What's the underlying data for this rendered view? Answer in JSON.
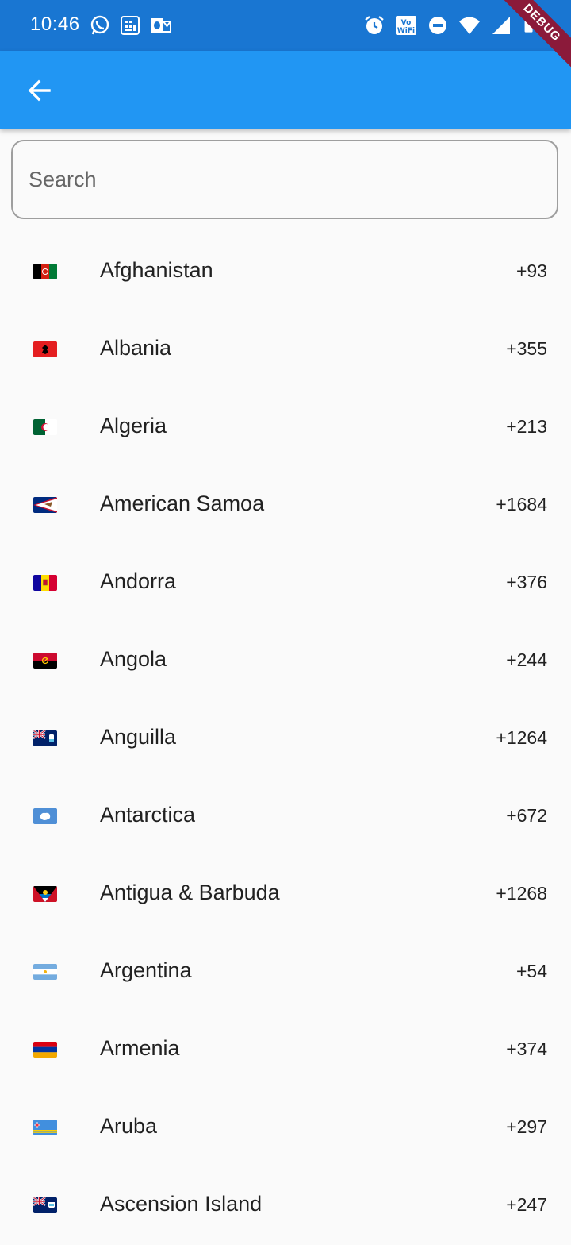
{
  "status_bar": {
    "time": "10:46",
    "left_icons": [
      "whatsapp-icon",
      "calculator-icon",
      "outlook-icon"
    ],
    "right_icons": [
      "alarm-icon",
      "vowifi-icon",
      "do-not-disturb-icon",
      "wifi-icon",
      "signal-icon",
      "battery-icon"
    ]
  },
  "debug_banner": "DEBUG",
  "app_bar": {
    "back_icon": "arrow-back-icon",
    "background": "#2196f3"
  },
  "search": {
    "placeholder": "Search",
    "value": ""
  },
  "countries": [
    {
      "name": "Afghanistan",
      "code": "+93",
      "flag": "afghanistan-flag-icon"
    },
    {
      "name": "Albania",
      "code": "+355",
      "flag": "albania-flag-icon"
    },
    {
      "name": "Algeria",
      "code": "+213",
      "flag": "algeria-flag-icon"
    },
    {
      "name": "American Samoa",
      "code": "+1684",
      "flag": "american-samoa-flag-icon"
    },
    {
      "name": "Andorra",
      "code": "+376",
      "flag": "andorra-flag-icon"
    },
    {
      "name": "Angola",
      "code": "+244",
      "flag": "angola-flag-icon"
    },
    {
      "name": "Anguilla",
      "code": "+1264",
      "flag": "anguilla-flag-icon"
    },
    {
      "name": "Antarctica",
      "code": "+672",
      "flag": "antarctica-flag-icon"
    },
    {
      "name": "Antigua & Barbuda",
      "code": "+1268",
      "flag": "antigua-barbuda-flag-icon"
    },
    {
      "name": "Argentina",
      "code": "+54",
      "flag": "argentina-flag-icon"
    },
    {
      "name": "Armenia",
      "code": "+374",
      "flag": "armenia-flag-icon"
    },
    {
      "name": "Aruba",
      "code": "+297",
      "flag": "aruba-flag-icon"
    },
    {
      "name": "Ascension Island",
      "code": "+247",
      "flag": "ascension-island-flag-icon"
    }
  ]
}
